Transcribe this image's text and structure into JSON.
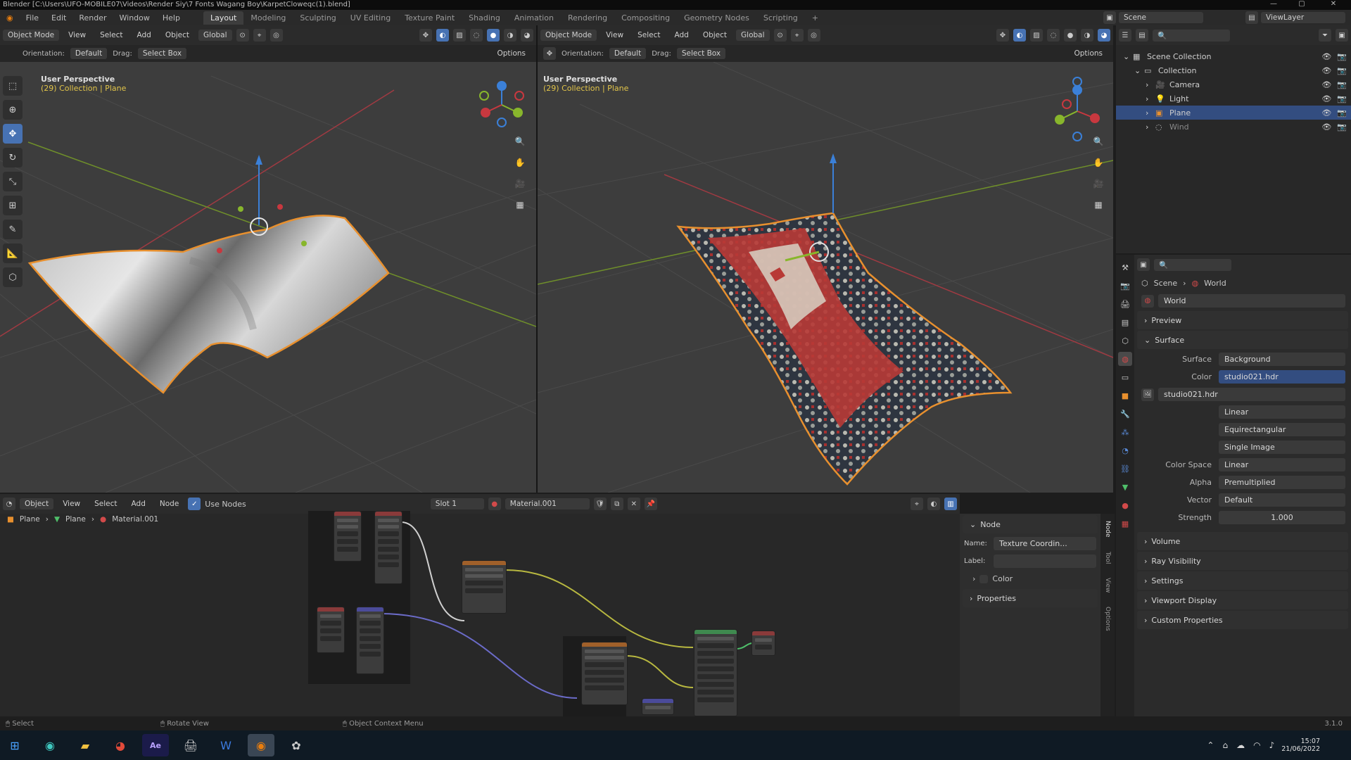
{
  "window": {
    "title": "Blender [C:\\Users\\UFO-MOBILE07\\Videos\\Render Siy\\7 Fonts Wagang Boy\\KarpetCloweqc(1).blend]",
    "controls": [
      "—",
      "▢",
      "✕"
    ]
  },
  "menu": {
    "items": [
      "File",
      "Edit",
      "Render",
      "Window",
      "Help"
    ],
    "workspaces": [
      "Layout",
      "Modeling",
      "Sculpting",
      "UV Editing",
      "Texture Paint",
      "Shading",
      "Animation",
      "Rendering",
      "Compositing",
      "Geometry Nodes",
      "Scripting"
    ],
    "active_workspace": "Layout",
    "add_workspace": "+",
    "scene_label": "Scene",
    "view_layer_label": "ViewLayer"
  },
  "viewport_left": {
    "mode": "Object Mode",
    "menus": [
      "View",
      "Select",
      "Add",
      "Object"
    ],
    "transform": "Global",
    "orientation_label": "Orientation:",
    "orientation_value": "Default",
    "drag_label": "Drag:",
    "drag_value": "Select Box",
    "options": "Options",
    "perspective": "User Perspective",
    "collection_path": "(29) Collection | Plane",
    "shading": "solid"
  },
  "viewport_right": {
    "mode": "Object Mode",
    "menus": [
      "View",
      "Select",
      "Add",
      "Object"
    ],
    "transform": "Global",
    "orientation_label": "Orientation:",
    "orientation_value": "Default",
    "drag_label": "Drag:",
    "drag_value": "Select Box",
    "options": "Options",
    "perspective": "User Perspective",
    "collection_path": "(29) Collection | Plane",
    "shading": "rendered"
  },
  "outliner": {
    "items": [
      {
        "label": "Scene Collection",
        "indent": 0,
        "selected": false
      },
      {
        "label": "Collection",
        "indent": 1,
        "selected": false
      },
      {
        "label": "Camera",
        "indent": 2,
        "selected": false
      },
      {
        "label": "Light",
        "indent": 2,
        "selected": false
      },
      {
        "label": "Plane",
        "indent": 2,
        "selected": true
      },
      {
        "label": "Wind",
        "indent": 2,
        "selected": false
      }
    ]
  },
  "properties": {
    "breadcrumb": [
      "Scene",
      "World"
    ],
    "world_name": "World",
    "panels_top": [
      "Preview",
      "Surface"
    ],
    "surface_label": "Surface",
    "surface_value": "Background",
    "color_label": "Color",
    "color_value": "studio021.hdr",
    "image_name": "studio021.hdr",
    "interpolation": "Linear",
    "projection": "Equirectangular",
    "source": "Single Image",
    "color_space_label": "Color Space",
    "color_space_value": "Linear",
    "alpha_label": "Alpha",
    "alpha_value": "Premultiplied",
    "vector_label": "Vector",
    "vector_value": "Default",
    "strength_label": "Strength",
    "strength_value": "1.000",
    "panels_bottom": [
      "Volume",
      "Ray Visibility",
      "Settings",
      "Viewport Display",
      "Custom Properties"
    ]
  },
  "node_editor": {
    "editor_type": "Object",
    "menus": [
      "View",
      "Select",
      "Add",
      "Node"
    ],
    "use_nodes": "Use Nodes",
    "slot": "Slot 1",
    "material": "Material.001",
    "breadcrumb": [
      "Plane",
      "Plane",
      "Material.001"
    ],
    "sidebar": {
      "section": "Node",
      "name_label": "Name:",
      "name_value": "Texture Coordin...",
      "label_label": "Label:",
      "label_value": "",
      "color_label": "Color",
      "properties": "Properties"
    },
    "side_tabs": [
      "Node",
      "Tool",
      "View",
      "Options"
    ]
  },
  "statusbar": {
    "items": [
      "Select",
      "Rotate View",
      "Object Context Menu"
    ],
    "version": "3.1.0"
  },
  "taskbar": {
    "clock_time": "15:07",
    "clock_date": "21/06/2022"
  },
  "colors": {
    "accent": "#4772b3",
    "selection_outline": "#e8902e",
    "viewport_bg": "#3d3d3d",
    "x_axis": "#c8383f",
    "y_axis": "#88b62c",
    "z_axis": "#3b80d8"
  }
}
